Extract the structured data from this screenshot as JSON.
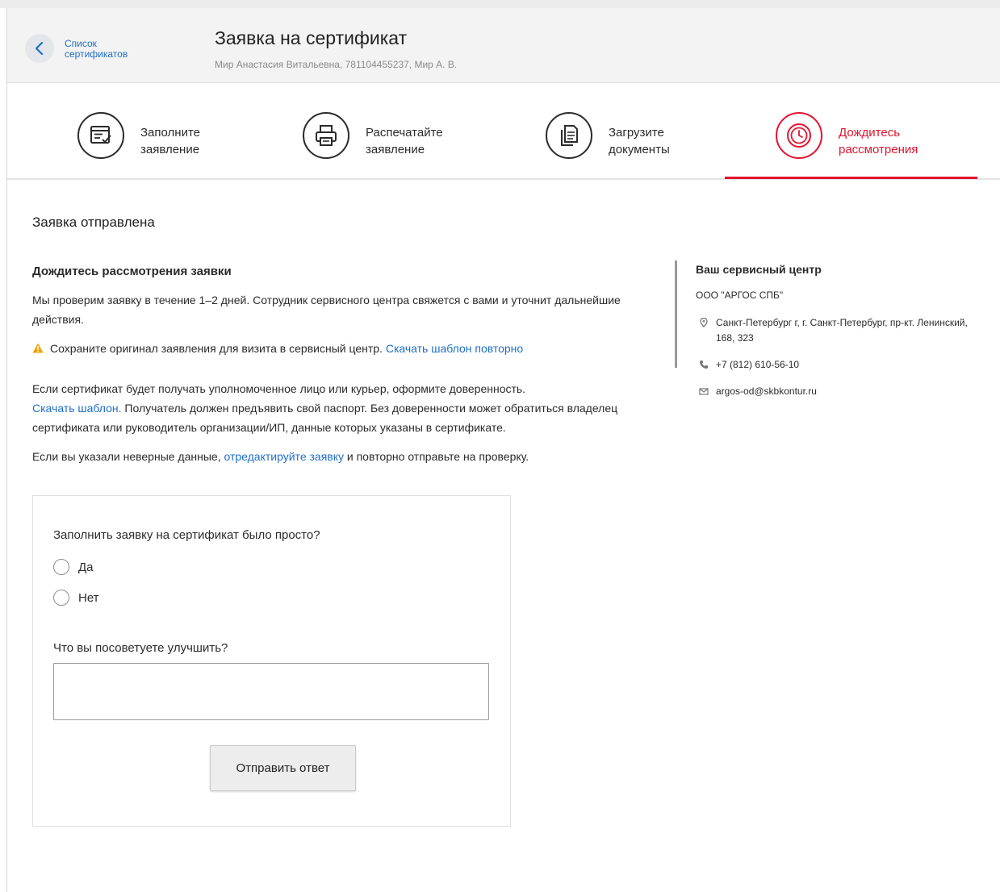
{
  "header": {
    "back_label": "Список сертификатов",
    "title": "Заявка на сертификат",
    "subtitle": "Мир Анастасия Витальевна, 781104455237, Мир А. В."
  },
  "steps": [
    {
      "label_line1": "Заполните",
      "label_line2": "заявление",
      "icon": "form-icon",
      "active": false
    },
    {
      "label_line1": "Распечатайте",
      "label_line2": "заявление",
      "icon": "printer-icon",
      "active": false
    },
    {
      "label_line1": "Загрузите",
      "label_line2": "документы",
      "icon": "documents-icon",
      "active": false
    },
    {
      "label_line1": "Дождитесь",
      "label_line2": "рассмотрения",
      "icon": "clock-icon",
      "active": true
    }
  ],
  "main": {
    "title": "Заявка отправлена",
    "section_title": "Дождитесь рассмотрения заявки",
    "p1": "Мы проверим заявку в течение 1–2 дней. Сотрудник сервисного центра свяжется с вами и уточнит дальнейшие действия.",
    "warning_text": "Сохраните оригинал заявления для визита в сервисный центр.",
    "warning_link": "Скачать шаблон повторно",
    "p3_text_a": "Если сертификат будет получать уполномоченное лицо или курьер, оформите доверенность.",
    "p3_link": "Скачать шаблон.",
    "p3_text_b": "Получатель должен предъявить свой паспорт. Без доверенности может обратиться владелец сертификата или руководитель организации/ИП, данные которых указаны в сертификате.",
    "p4_text_a": "Если вы указали неверные данные,",
    "p4_link": "отредактируйте заявку",
    "p4_text_b": "и повторно отправьте на проверку."
  },
  "service_center": {
    "title": "Ваш сервисный центр",
    "name": "ООО \"АРГОС СПБ\"",
    "address": "Санкт-Петербург г, г. Санкт-Петербург, пр-кт. Ленинский, 168, 323",
    "phone": "+7 (812) 610-56-10",
    "email": "argos-od@skbkontur.ru"
  },
  "survey": {
    "question1": "Заполнить заявку на сертификат было просто?",
    "options": [
      "Да",
      "Нет"
    ],
    "question2": "Что вы посоветуете улучшить?",
    "textarea_value": "",
    "submit_label": "Отправить ответ"
  },
  "colors": {
    "accent": "#e3142f",
    "link": "#1f6fc5",
    "warning": "#f2a20c"
  }
}
